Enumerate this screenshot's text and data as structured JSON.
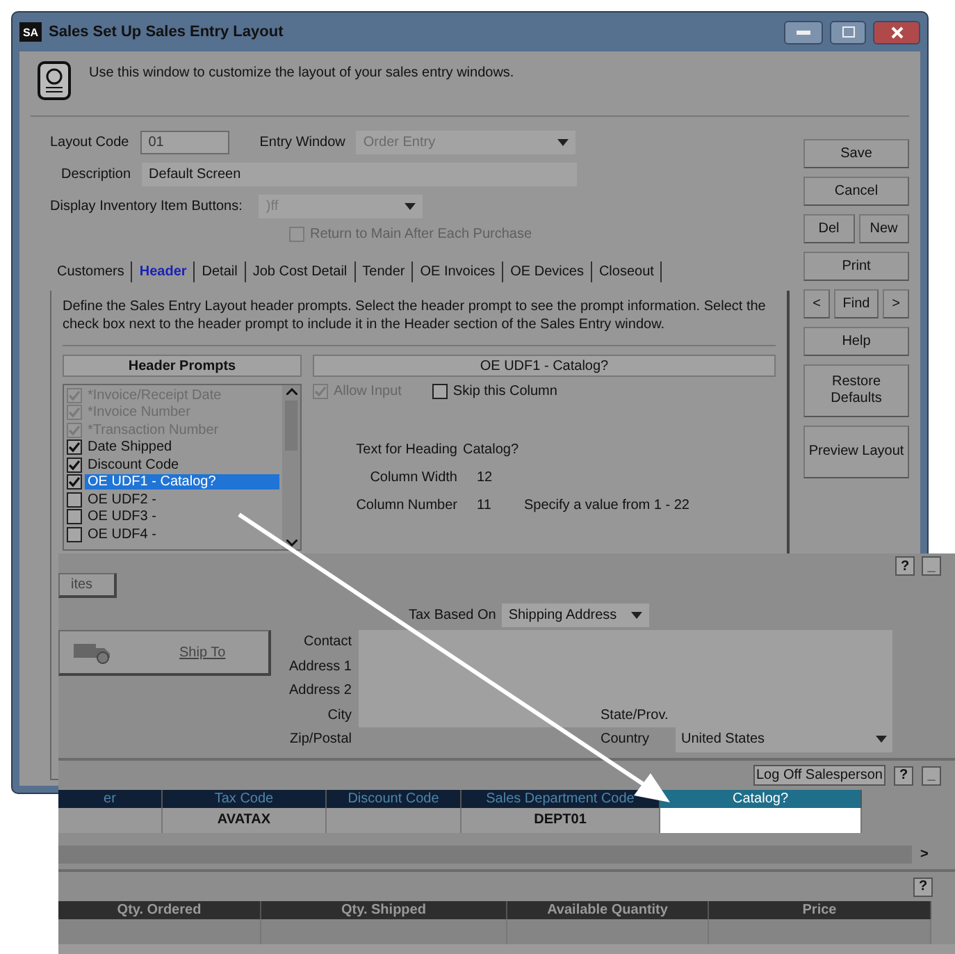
{
  "dialog": {
    "app_badge": "SA",
    "title": "Sales Set Up Sales Entry Layout",
    "intro": "Use this window to customize the layout of your sales entry windows.",
    "layout_code": {
      "label": "Layout Code",
      "value": "01"
    },
    "entry_window": {
      "label": "Entry Window",
      "value": "Order Entry"
    },
    "description": {
      "label": "Description",
      "value": "Default Screen"
    },
    "inventory_buttons": {
      "label": "Display Inventory Item Buttons:",
      "value": ")ff"
    },
    "return_option": {
      "label": "Return to Main After Each Purchase",
      "checked": false,
      "disabled": true
    },
    "tabs": [
      {
        "label": "Customers",
        "selected": false
      },
      {
        "label": "Header",
        "selected": true
      },
      {
        "label": "Detail",
        "selected": false
      },
      {
        "label": "Job Cost Detail",
        "selected": false
      },
      {
        "label": "Tender",
        "selected": false
      },
      {
        "label": "OE Invoices",
        "selected": false
      },
      {
        "label": "OE Devices",
        "selected": false
      },
      {
        "label": "Closeout",
        "selected": false
      }
    ],
    "instructions": "Define the Sales Entry Layout header prompts. Select the header prompt to see the prompt information. Select the check box next to the header prompt to include it in the Header section of the Sales Entry window.",
    "prompts": {
      "heading": "Header Prompts",
      "items": [
        {
          "label": "*Invoice/Receipt Date",
          "checked": true,
          "disabled": true,
          "selected": false
        },
        {
          "label": "*Invoice Number",
          "checked": true,
          "disabled": true,
          "selected": false
        },
        {
          "label": "*Transaction Number",
          "checked": true,
          "disabled": true,
          "selected": false
        },
        {
          "label": "Date Shipped",
          "checked": true,
          "disabled": false,
          "selected": false
        },
        {
          "label": "Discount Code",
          "checked": true,
          "disabled": false,
          "selected": false
        },
        {
          "label": "OE UDF1 - Catalog?",
          "checked": true,
          "disabled": false,
          "selected": true
        },
        {
          "label": "OE UDF2 -",
          "checked": false,
          "disabled": false,
          "selected": false
        },
        {
          "label": "OE UDF3 -",
          "checked": false,
          "disabled": false,
          "selected": false
        },
        {
          "label": "OE UDF4 -",
          "checked": false,
          "disabled": false,
          "selected": false
        }
      ]
    },
    "prompt_info": {
      "heading": "OE UDF1 - Catalog?",
      "allow_input": {
        "label": "Allow Input",
        "checked": true,
        "disabled": true
      },
      "skip_column": {
        "label": "Skip this Column",
        "checked": false,
        "disabled": false
      },
      "rows": [
        {
          "label": "Text for Heading",
          "value": "Catalog?"
        },
        {
          "label": "Column Width",
          "value": "12"
        },
        {
          "label": "Column Number",
          "value": "11",
          "note": "Specify a value from 1 - 22"
        }
      ]
    },
    "button_rows": [
      [
        {
          "label": "Save"
        }
      ],
      [
        {
          "label": "Cancel"
        }
      ],
      [
        {
          "label": "Del"
        },
        {
          "label": "New"
        }
      ],
      [
        {
          "label": "Print"
        }
      ],
      [
        {
          "label": "<"
        },
        {
          "label": "Find"
        },
        {
          "label": ">"
        }
      ],
      [
        {
          "label": "Help"
        }
      ],
      [
        {
          "label": "Restore Defaults"
        }
      ],
      [
        {
          "label": "Preview Layout"
        }
      ]
    ]
  },
  "sales_entry": {
    "top_help": "?",
    "top_min": "_",
    "partial_button": "ites",
    "tax_based_on": {
      "label": "Tax Based On",
      "value": "Shipping Address"
    },
    "ship_to": "Ship To",
    "address_labels": {
      "contact": "Contact",
      "address1": "Address 1",
      "address2": "Address 2",
      "city": "City",
      "zip": "Zip/Postal",
      "state": "State/Prov.",
      "country": "Country"
    },
    "country": "United States",
    "log_off": "Log Off Salesperson",
    "help": "?",
    "minimize": "_",
    "header_table": {
      "columns": [
        {
          "label": "er",
          "highlighted": false
        },
        {
          "label": "Tax Code",
          "value": "AVATAX",
          "highlighted": false
        },
        {
          "label": "Discount Code",
          "highlighted": false
        },
        {
          "label": "Sales Department Code",
          "value": "DEPT01",
          "highlighted": false
        },
        {
          "label": "Catalog?",
          "highlighted": true
        }
      ]
    },
    "scroll_right": ">",
    "detail_help": "?",
    "detail_table": {
      "columns": [
        "Qty. Ordered",
        "Qty. Shipped",
        "Available Quantity",
        "Price"
      ]
    }
  }
}
